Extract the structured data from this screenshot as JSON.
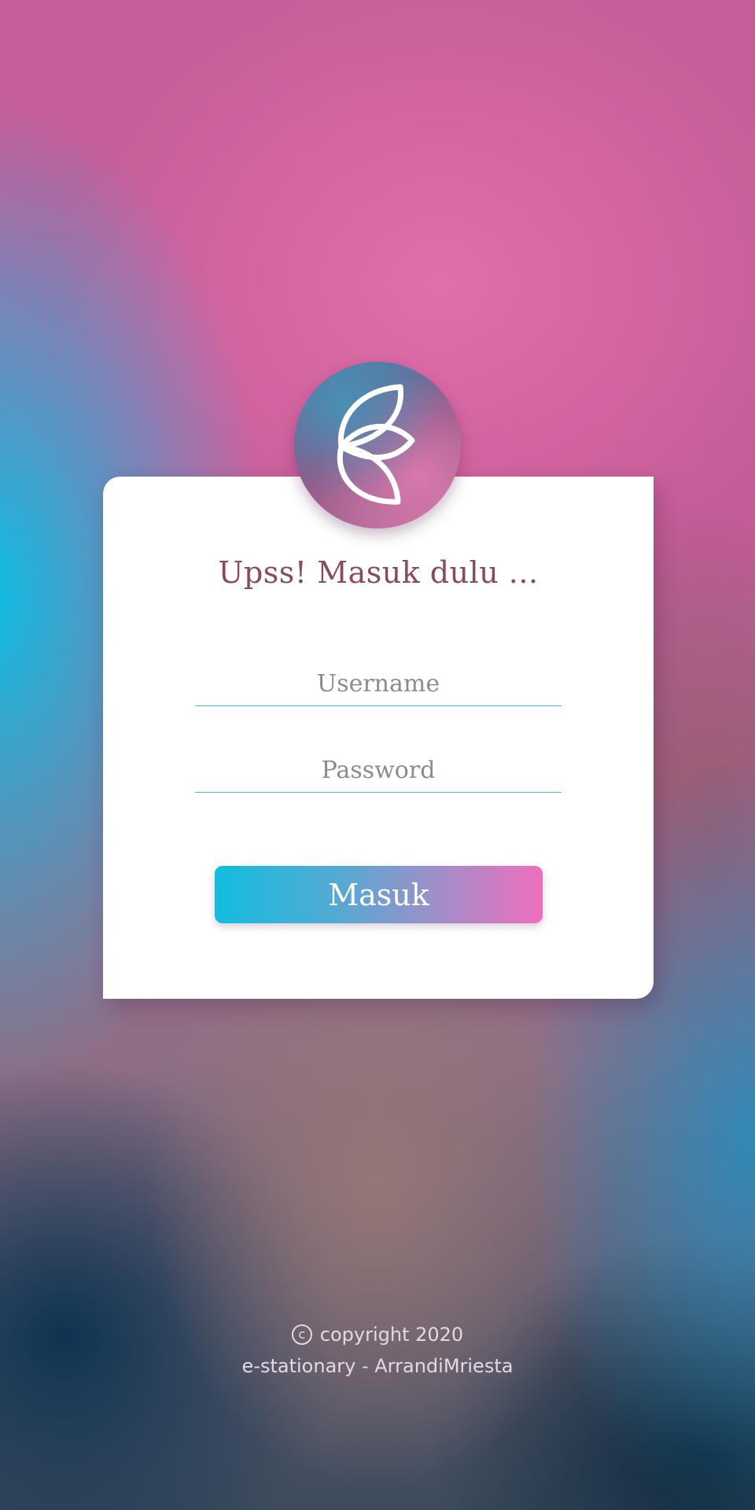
{
  "login": {
    "title": "Upss! Masuk dulu ...",
    "username_placeholder": "Username",
    "password_placeholder": "Password",
    "submit_label": "Masuk"
  },
  "footer": {
    "copyright_symbol": "c",
    "copyright_text": "copyright 2020",
    "credit_text": "e-stationary - ArrandiMriesta"
  },
  "colors": {
    "title": "#8a4a5c",
    "input_underline": "#3cc2dc",
    "button_gradient_start": "#12bddf",
    "button_gradient_end": "#ee6fbe"
  },
  "icons": {
    "logo": "leaf-logo-icon",
    "copyright": "copyright-icon"
  }
}
